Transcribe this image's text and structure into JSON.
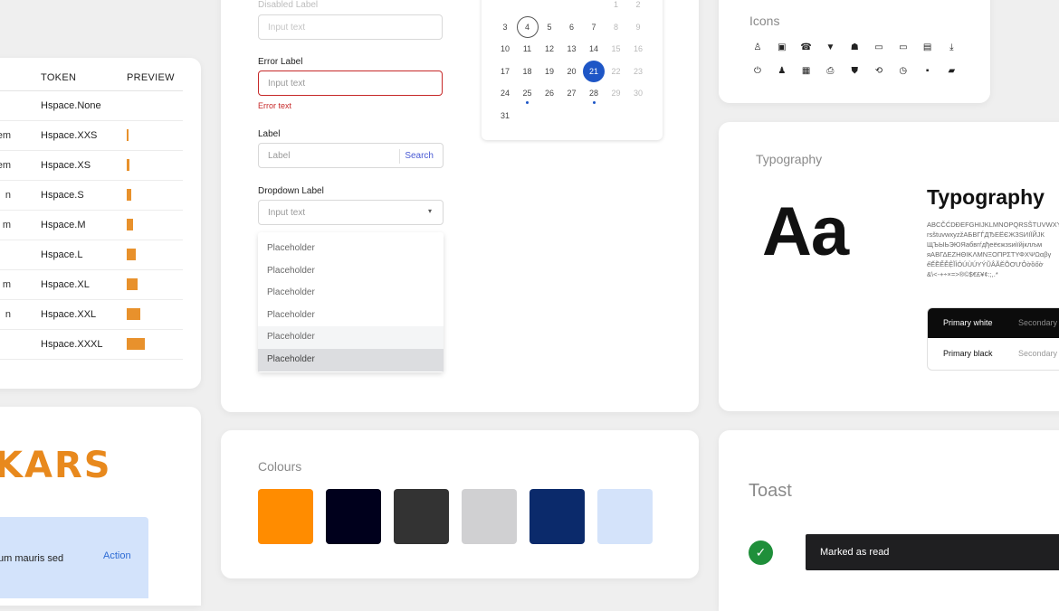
{
  "tokens": {
    "headers": {
      "token": "TOKEN",
      "preview": "PREVIEW"
    },
    "rows": [
      {
        "prefix": "",
        "name": "Hspace.None",
        "bar": 0
      },
      {
        "prefix": "em",
        "name": "Hspace.XXS",
        "bar": 2
      },
      {
        "prefix": "em",
        "name": "Hspace.XS",
        "bar": 3
      },
      {
        "prefix": "n",
        "name": "Hspace.S",
        "bar": 5
      },
      {
        "prefix": "m",
        "name": "Hspace.M",
        "bar": 7
      },
      {
        "prefix": "",
        "name": "Hspace.L",
        "bar": 10
      },
      {
        "prefix": "m",
        "name": "Hspace.XL",
        "bar": 12
      },
      {
        "prefix": "n",
        "name": "Hspace.XXL",
        "bar": 15
      },
      {
        "prefix": "",
        "name": "Hspace.XXXL",
        "bar": 20
      }
    ]
  },
  "form": {
    "disabled_label": "Disabled Label",
    "disabled_placeholder": "Input text",
    "error_label": "Error Label",
    "error_placeholder": "Input text",
    "error_text": "Error text",
    "search_label": "Label",
    "search_placeholder": "Label",
    "search_button": "Search",
    "dropdown_label": "Dropdown Label",
    "dropdown_value": "Input text",
    "dropdown_items": [
      "Placeholder",
      "Placeholder",
      "Placeholder",
      "Placeholder",
      "Placeholder",
      "Placeholder"
    ]
  },
  "calendar": {
    "weeks": [
      [
        "",
        "",
        "",
        "",
        "",
        "1",
        "2"
      ],
      [
        "3",
        "4",
        "5",
        "6",
        "7",
        "8",
        "9"
      ],
      [
        "10",
        "11",
        "12",
        "13",
        "14",
        "15",
        "16"
      ],
      [
        "17",
        "18",
        "19",
        "20",
        "21",
        "22",
        "23"
      ],
      [
        "24",
        "25",
        "26",
        "27",
        "28",
        "29",
        "30"
      ],
      [
        "31",
        "",
        "",
        "",
        "",
        "",
        ""
      ]
    ],
    "today": "4",
    "selected": "21",
    "accent": "#1e56c6"
  },
  "icons_card": {
    "title": "Icons",
    "row1": [
      "person-icon",
      "photo-library-icon",
      "phone-forward-icon",
      "wifi-icon",
      "pets-icon",
      "picture-in-picture-icon",
      "picture-in-picture-alt-icon",
      "description-icon",
      "download-icon"
    ],
    "row2": [
      "power-icon",
      "accessibility-icon",
      "memory-icon",
      "print-icon",
      "shield-icon",
      "sync-icon",
      "clock-icon",
      "chat-icon",
      "forum-icon"
    ]
  },
  "typography": {
    "title": "Typography",
    "sample": "Aa",
    "heading": "Typography",
    "glyph_lines": [
      "ABCČĆDĐEFGHIJKLMNOPQRSŠTUVWXYZŽ",
      "rsštuvwxyzžАБВГЃДЂЕЁЄЖЗЅИІЇЙЈК",
      "ЩЪЫЬЭЮЯабвгѓдђеёєжзѕиіїйјклљм",
      "яΑΒΓΔΕΖΗΘΙΚΛΜΝΞΟΠΡΣΤΥΦΧΨΩαβγ",
      "ếẾỀỂỄỆĨÍÓÚÙÚYÝŨÂÃĔÕƠƯỎờồốờ",
      "&\\<-+÷×=>®©$€£¥¢:;,.*"
    ],
    "primary_white": "Primary white",
    "secondary_1": "Secondary",
    "primary_black": "Primary black",
    "secondary_2": "Secondary"
  },
  "logo": {
    "text": "KARS",
    "brand": "#e8891d",
    "banner_text": "um mauris sed",
    "banner_action": "Action"
  },
  "colours": {
    "title": "Colours",
    "swatches": [
      "#ff8c00",
      "#00001c",
      "#333333",
      "#d0d0d2",
      "#0b2a6b",
      "#d4e3fa"
    ]
  },
  "toast": {
    "title": "Toast",
    "message": "Marked as read",
    "success": "#1f8f3a"
  }
}
